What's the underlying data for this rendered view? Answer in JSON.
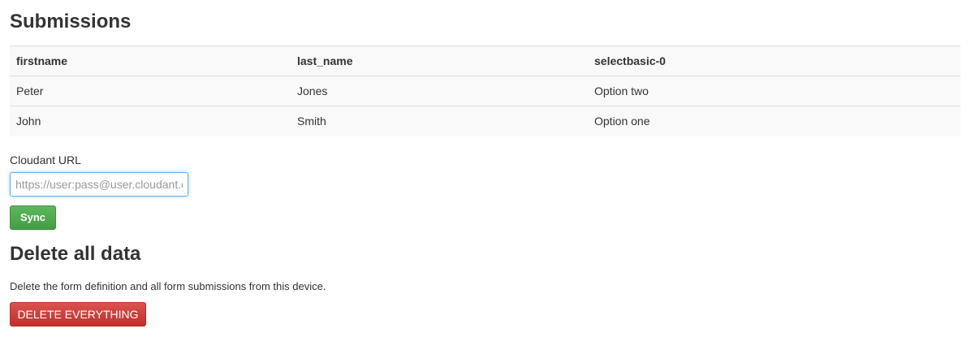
{
  "submissions": {
    "title": "Submissions",
    "columns": [
      "firstname",
      "last_name",
      "selectbasic-0"
    ],
    "rows": [
      [
        "Peter",
        "Jones",
        "Option two"
      ],
      [
        "John",
        "Smith",
        "Option one"
      ]
    ]
  },
  "sync": {
    "label": "Cloudant URL",
    "placeholder": "https://user:pass@user.cloudant.com/database",
    "button": "Sync",
    "button_color": "#5cb85c"
  },
  "delete": {
    "title": "Delete all data",
    "description": "Delete the form definition and all form submissions from this device.",
    "button": "DELETE EVERYTHING",
    "button_color": "#d9534f"
  }
}
